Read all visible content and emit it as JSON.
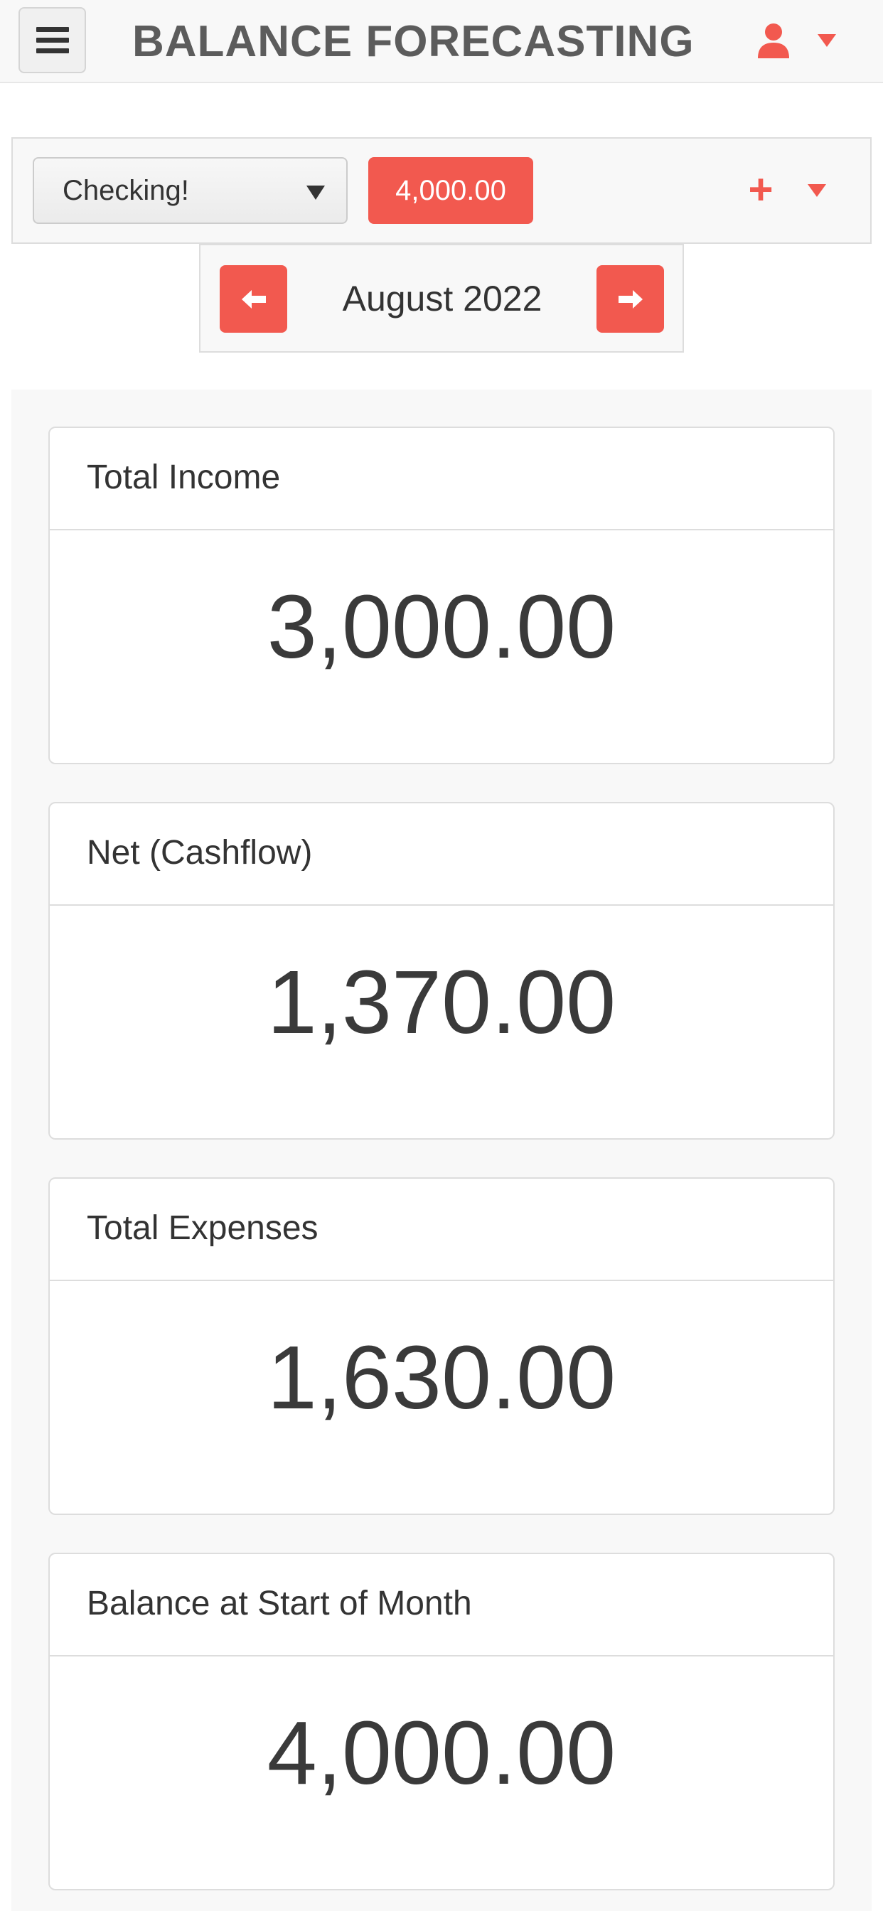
{
  "header": {
    "title": "BALANCE FORECASTING",
    "menu_icon": "hamburger-icon",
    "user_icon": "user-icon",
    "accent_color": "#f2594f"
  },
  "account_bar": {
    "selected_account": "Checking!",
    "balance": "4,000.00",
    "add_icon": "plus-icon"
  },
  "month_nav": {
    "month": "August 2022",
    "prev_icon": "arrow-left-icon",
    "next_icon": "arrow-right-icon"
  },
  "cards": [
    {
      "label": "Total Income",
      "value": "3,000.00"
    },
    {
      "label": "Net (Cashflow)",
      "value": "1,370.00"
    },
    {
      "label": "Total Expenses",
      "value": "1,630.00"
    },
    {
      "label": "Balance at Start of Month",
      "value": "4,000.00"
    }
  ]
}
